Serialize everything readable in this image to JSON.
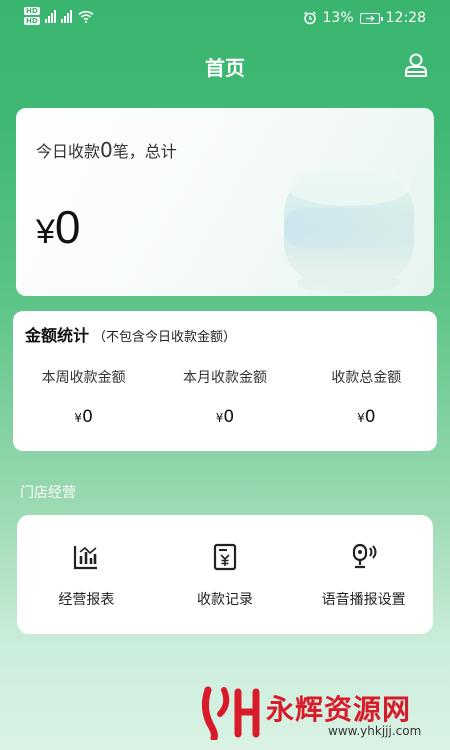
{
  "status_bar": {
    "network_badge_1": "HD",
    "network_badge_2": "HD",
    "network_type_1": "4G",
    "network_type_2": "4G",
    "battery_percent": "13%",
    "time": "12:28"
  },
  "header": {
    "title": "首页",
    "profile_icon": "user-icon"
  },
  "summary": {
    "count_prefix": "今日收款",
    "count": "0",
    "count_suffix": "笔，总计",
    "currency": "¥",
    "total_amount": "0"
  },
  "stats": {
    "title": "金额统计",
    "subtitle": "（不包含今日收款金额）",
    "items": [
      {
        "label": "本周收款金额",
        "currency": "¥",
        "value": "0"
      },
      {
        "label": "本月收款金额",
        "currency": "¥",
        "value": "0"
      },
      {
        "label": "收款总金额",
        "currency": "¥",
        "value": "0"
      }
    ]
  },
  "store_section": {
    "title": "门店经营",
    "items": [
      {
        "label": "经营报表",
        "icon": "bar-chart-icon"
      },
      {
        "label": "收款记录",
        "icon": "receipt-icon"
      },
      {
        "label": "语音播报设置",
        "icon": "voice-broadcast-icon"
      }
    ]
  },
  "watermark": {
    "brand": "永辉资源网",
    "url": "www.yhkjjj.com"
  },
  "colors": {
    "primary_green": "#3fb874",
    "watermark_red": "#d81b2a"
  }
}
